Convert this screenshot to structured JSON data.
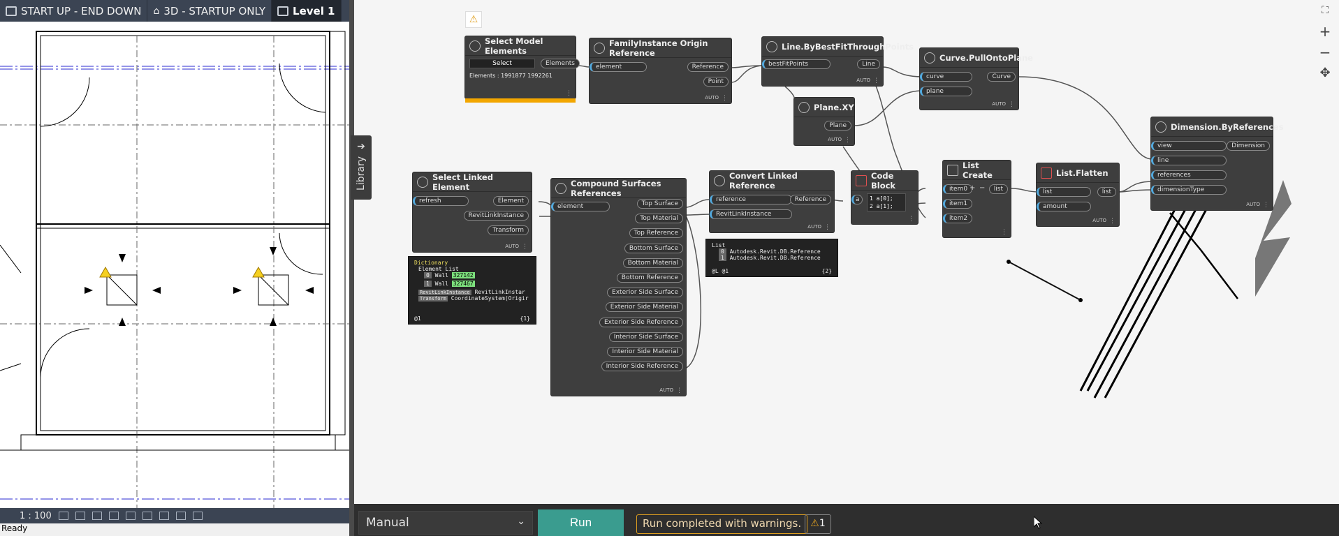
{
  "revit": {
    "tabs": [
      {
        "label": "START UP - END DOWN"
      },
      {
        "label": "3D - STARTUP ONLY"
      },
      {
        "label": "Level 1"
      }
    ],
    "scale": "1 : 100",
    "status": "Ready"
  },
  "library": {
    "label": "Library"
  },
  "nodes": {
    "select_model": {
      "title": "Select Model Elements",
      "button": "Select",
      "output": "Elements",
      "info": "Elements : 1991877 1992261"
    },
    "fi_origin": {
      "title": "FamilyInstance Origin Reference",
      "input": "element",
      "out1": "Reference",
      "out2": "Point",
      "lacing": "AUTO"
    },
    "line_best": {
      "title": "Line.ByBestFitThroughPoints",
      "input": "bestFitPoints",
      "output": "Line",
      "lacing": "AUTO"
    },
    "plane_xy": {
      "title": "Plane.XY",
      "output": "Plane",
      "lacing": "AUTO"
    },
    "curve_pull": {
      "title": "Curve.PullOntoPlane",
      "in1": "curve",
      "in2": "plane",
      "output": "Curve",
      "lacing": "AUTO"
    },
    "dim_refs": {
      "title": "Dimension.ByReferences",
      "in1": "view",
      "in2": "line",
      "in3": "references",
      "in4": "dimensionType",
      "output": "Dimension",
      "lacing": "AUTO"
    },
    "select_linked": {
      "title": "Select Linked Element",
      "input": "refresh",
      "out1": "Element",
      "out2": "RevitLinkInstance",
      "out3": "Transform",
      "lacing": "AUTO"
    },
    "compound": {
      "title": "Compound Surfaces References",
      "input": "element",
      "outputs": [
        "Top Surface",
        "Top Material",
        "Top Reference",
        "Bottom Surface",
        "Bottom Material",
        "Bottom Reference",
        "Exterior Side Surface",
        "Exterior Side Material",
        "Exterior Side Reference",
        "Interior Side Surface",
        "Interior Side Material",
        "Interior Side Reference"
      ],
      "lacing": "AUTO"
    },
    "convert_linked": {
      "title": "Convert Linked Reference",
      "in1": "reference",
      "in2": "RevitLinkInstance",
      "output": "Reference",
      "lacing": "AUTO"
    },
    "code_block": {
      "title": "Code Block",
      "input": "a",
      "line1": "1 a[0];",
      "line2": "2 a[1];",
      "lacing": "AUTO"
    },
    "list_create": {
      "title": "List Create",
      "in1": "item0",
      "in2": "item1",
      "in3": "item2",
      "output": "list",
      "plus": "+",
      "minus": "−"
    },
    "list_flatten": {
      "title": "List.Flatten",
      "in1": "list",
      "in2": "amount",
      "output": "list",
      "lacing": "AUTO"
    }
  },
  "previews": {
    "dict": {
      "l1": "Dictionary",
      "l2": "Element List",
      "l3k": "0",
      "l3": "Wall",
      "l3v": "327142",
      "l4k": "1",
      "l4": "Wall",
      "l4v": "327467",
      "l5k": "RevitLinkInstance",
      "l5": "RevitLinkInstar",
      "l6k": "Transform",
      "l6": "CoordinateSystem(Origir",
      "foot_l": "@1",
      "foot_r": "{1}"
    },
    "convert": {
      "l1": "List",
      "l2k": "0",
      "l2": "Autodesk.Revit.DB.Reference",
      "l3k": "1",
      "l3": "Autodesk.Revit.DB.Reference",
      "foot_l": "@L @1",
      "foot_r": "{2}"
    }
  },
  "bottom": {
    "mode": "Manual",
    "run": "Run",
    "message": "Run completed with warnings.",
    "warn_count": "1"
  },
  "colors": {
    "accent": "#3a9c8f",
    "warning": "#e0a020",
    "port_in": "#52a9dd",
    "node_bg": "#3e3e3e",
    "canvas": "#f5f5f5"
  },
  "zoom": {
    "plus": "+",
    "minus": "−"
  }
}
